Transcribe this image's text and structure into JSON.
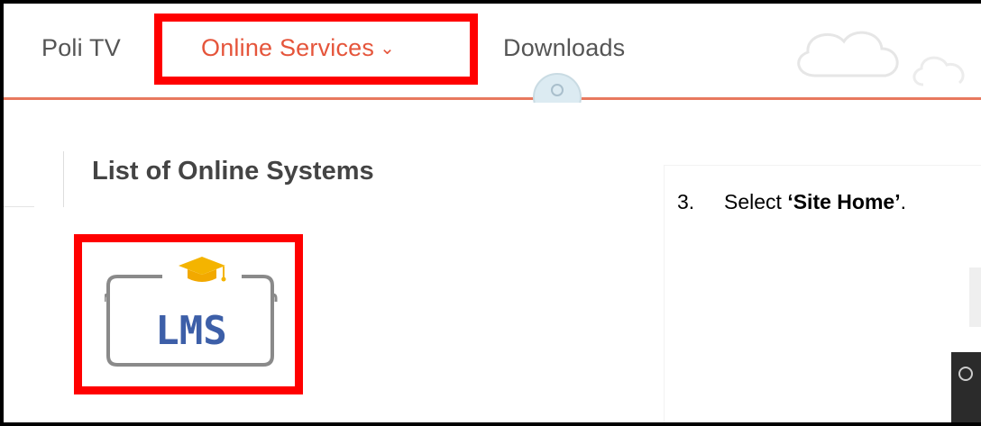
{
  "nav": {
    "items": [
      {
        "label": "Poli TV"
      },
      {
        "label": "Online Services",
        "chevron": "⌄",
        "active": true
      },
      {
        "label": "Downloads"
      }
    ],
    "active_color": "#e5553b",
    "underline_color": "#e8795e"
  },
  "main": {
    "section_title": "List of Online Systems",
    "systems": [
      {
        "name": "LMS",
        "icon": "graduation-cap-icon"
      }
    ]
  },
  "instruction": {
    "step_number": "3.",
    "prefix": "Select ",
    "target": "‘Site Home’",
    "suffix": "."
  },
  "highlight_color": "#ff0000"
}
